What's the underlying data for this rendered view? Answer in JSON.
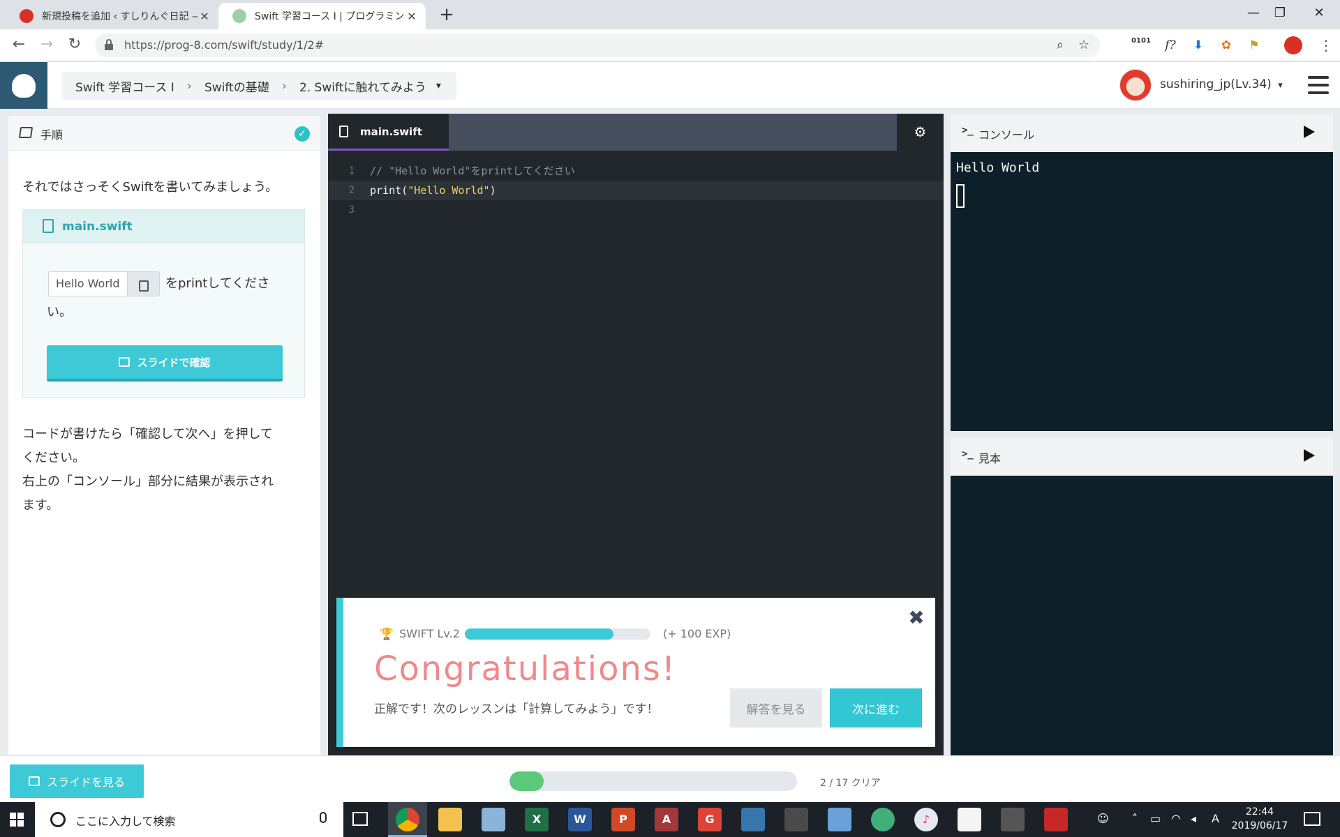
{
  "browser": {
    "tabs": [
      {
        "title": "新規投稿を追加 ‹ すしりんぐ日記 —",
        "close": "✕",
        "active": false
      },
      {
        "title": "Swift 学習コース Ⅰ | プログラミングの",
        "close": "✕",
        "active": true
      }
    ],
    "new_tab": "+",
    "window_controls": {
      "minimize": "—",
      "restore": "❐",
      "close": "✕"
    },
    "nav": {
      "back": "←",
      "forward": "→",
      "reload": "↻"
    },
    "url": "https://prog-8.com/swift/study/1/2#",
    "extensions": [
      "0101",
      "f?",
      "⬇",
      "✿",
      "⚑"
    ]
  },
  "header": {
    "breadcrumb": [
      "Swift 学習コース Ⅰ",
      "Swiftの基礎",
      "2. Swiftに触れてみよう"
    ],
    "breadcrumb_sep": "›",
    "dropdown_caret": "▾",
    "username": "sushiring_jp(Lv.34)",
    "user_caret": "▾"
  },
  "left": {
    "title": "手順",
    "check": "✓",
    "intro": "それではさっそくSwiftを書いてみましょう。",
    "file_name": "main.swift",
    "snippet": "Hello World",
    "instruction_1": "をprintしてくださ",
    "instruction_2": "い。",
    "slide_button": "スライドで確認",
    "outro_1": "コードが書けたら「確認して次へ」を押して",
    "outro_2": "ください。",
    "outro_3": "右上の「コンソール」部分に結果が表示され",
    "outro_4": "ます。"
  },
  "editor": {
    "tab": "main.swift",
    "settings_icon": "⚙",
    "lines": [
      {
        "n": "1",
        "comment": "// \"Hello World\"をprintしてください"
      },
      {
        "n": "2",
        "kw": "print(",
        "str": "\"Hello World\"",
        "end": ")"
      },
      {
        "n": "3"
      }
    ]
  },
  "modal": {
    "close": "✖",
    "trophy": "🏆",
    "level": "SWIFT Lv.2",
    "exp_progress": 0.8,
    "exp": "(+ 100 EXP)",
    "title": "Congratulations!",
    "message": "正解です！次のレッスンは「計算してみよう」です！",
    "answer_button": "解答を見る",
    "next_button": "次に進む"
  },
  "console": {
    "prompt": ">_",
    "title": "コンソール",
    "output": "Hello World"
  },
  "sample": {
    "prompt": ">_",
    "title": "見本"
  },
  "footer": {
    "slide_button": "スライドを見る",
    "progress": 0.118,
    "progress_label": "2 / 17 クリア"
  },
  "taskbar": {
    "search_placeholder": "ここに入力して検索",
    "apps": [
      "Chrome",
      "Files",
      "Mail",
      "Excel",
      "Word",
      "PowerPoint",
      "Access",
      "Mail",
      "Python",
      "Store",
      "Paint",
      "Atom",
      "iTunes",
      "Cat",
      "Tube",
      "PDF"
    ],
    "tray_lang": "A",
    "time": "22:44",
    "date": "2019/06/17"
  }
}
